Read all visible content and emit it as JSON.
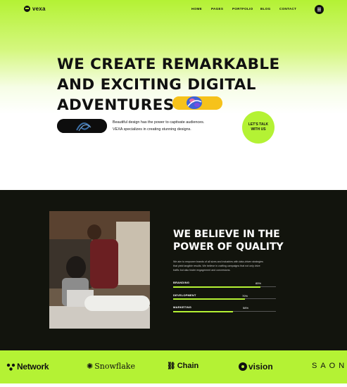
{
  "nav": {
    "logo": "vexa",
    "items": [
      "HOME",
      "PAGES",
      "PORTFOLIO",
      "BLOG",
      "CONTACT"
    ]
  },
  "hero": {
    "headline_lines": [
      "WE CREATE REMARKABLE",
      "AND EXCITING DIGITAL",
      "ADVENTURES"
    ],
    "tagline_lines": [
      "Beautiful design has the power to captivate audiences.",
      "VEXA specializes in creating stunning designs."
    ],
    "cta_lines": [
      "LET'S TALK",
      "WITH US"
    ]
  },
  "quality": {
    "title_lines": [
      "WE BELIEVE IN THE",
      "POWER OF QUALITY"
    ],
    "paragraph_lines": [
      "We aim to empower brands of all sizes and industries with data-driven strategies",
      "that yield tangible results. We believe in crafting campaigns that not only drive",
      "traffic but also foster engagement and conversions."
    ],
    "skills": [
      {
        "label": "BRANDING",
        "value": "85%",
        "fraction": 0.85
      },
      {
        "label": "DEVELOPMENT",
        "value": "70%",
        "fraction": 0.7
      },
      {
        "label": "MARKETING",
        "value": "58%",
        "fraction": 0.58
      }
    ]
  },
  "brands": [
    "Network",
    "Snowflake",
    "Chain",
    "vision",
    "SAONA"
  ],
  "colors": {
    "accent": "#b4f234",
    "dark": "#12140d",
    "text": "#111111"
  }
}
